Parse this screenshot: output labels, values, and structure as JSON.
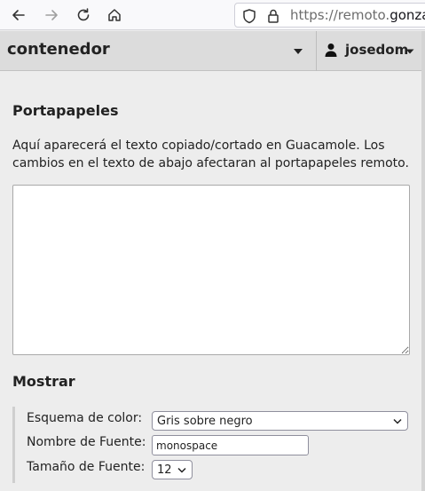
{
  "browser": {
    "url_prefix": "https://remoto.",
    "url_domain": "gonzalo",
    "icons": [
      "back-arrow-icon",
      "forward-arrow-icon",
      "reload-icon",
      "home-icon",
      "shield-icon",
      "lock-icon"
    ]
  },
  "header": {
    "connection_name": "contenedor",
    "user_name": "josedom"
  },
  "clipboard": {
    "title": "Portapapeles",
    "description": "Aquí aparecerá el texto copiado/cortado en Guacamole. Los cambios en el texto de abajo afectaran al portapapeles remoto.",
    "content": ""
  },
  "display": {
    "title": "Mostrar",
    "color_scheme_label": "Esquema de color:",
    "color_scheme_value": "Gris sobre negro",
    "font_name_label": "Nombre de Fuente:",
    "font_name_value": "monospace",
    "font_size_label": "Tamaño de Fuente:",
    "font_size_value": "12"
  },
  "colors": {
    "header_bg": "#dcdcdc",
    "page_bg": "#ededed",
    "text": "#222222"
  }
}
